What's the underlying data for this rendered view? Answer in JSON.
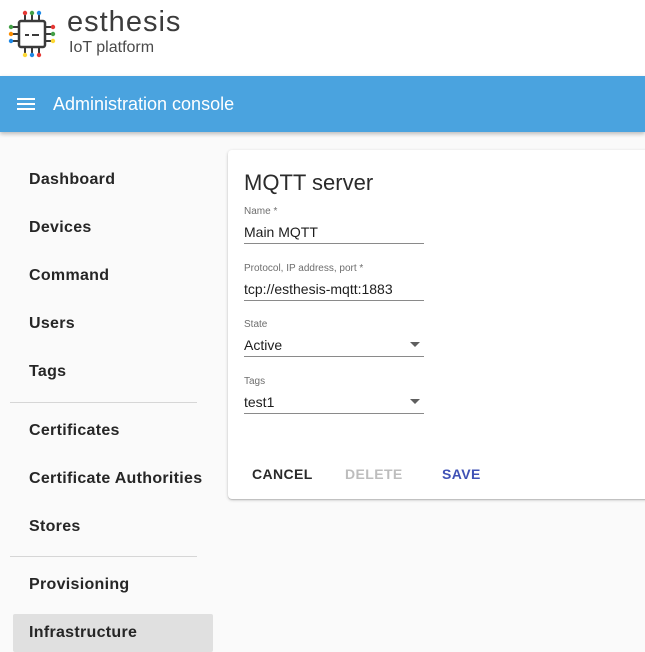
{
  "brand": {
    "name": "esthesis",
    "subtitle": "IoT platform",
    "logo_icon": "chip-icon"
  },
  "toolbar": {
    "menu_icon": "hamburger-menu-icon",
    "title": "Administration console",
    "color": "#4aa3df"
  },
  "sidebar": {
    "items": [
      {
        "label": "Dashboard"
      },
      {
        "label": "Devices"
      },
      {
        "label": "Command"
      },
      {
        "label": "Users"
      },
      {
        "label": "Tags"
      },
      {
        "label": "Certificates"
      },
      {
        "label": "Certificate Authorities"
      },
      {
        "label": "Stores"
      },
      {
        "label": "Provisioning"
      },
      {
        "label": "Infrastructure",
        "active": true
      }
    ]
  },
  "form": {
    "title": "MQTT server",
    "name": {
      "label": "Name *",
      "value": "Main MQTT"
    },
    "address": {
      "label": "Protocol, IP address, port *",
      "value": "tcp://esthesis-mqtt:1883"
    },
    "state": {
      "label": "State",
      "value": "Active"
    },
    "tags": {
      "label": "Tags",
      "value": "test1"
    },
    "buttons": {
      "cancel": "CANCEL",
      "delete": "DELETE",
      "save": "SAVE"
    },
    "accent": "#3f51b5"
  }
}
